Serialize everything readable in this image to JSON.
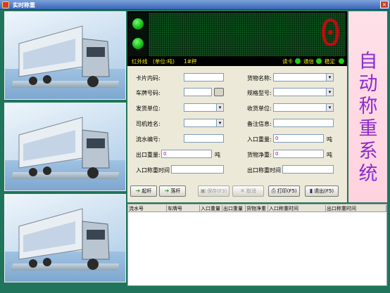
{
  "window": {
    "title": "实时称重"
  },
  "display": {
    "weight_value": "0",
    "infrared_label": "红外线",
    "unit_label": "(单位:吨)",
    "scale_label": "1#秤",
    "read_card_label": "读卡",
    "comm_label": "通信",
    "stable_label": "稳定"
  },
  "side_title": [
    "自",
    "动",
    "称",
    "重",
    "系",
    "统"
  ],
  "form": {
    "card_code_label": "卡片内码:",
    "plate_label": "车牌号码:",
    "shipper_label": "发货单位:",
    "driver_label": "司机姓名:",
    "serial_label": "流水编号:",
    "out_weight_label": "出口重量:",
    "in_time_label": "入口称重时间",
    "goods_name_label": "货物名称:",
    "spec_label": "规格型号:",
    "receiver_label": "收货单位:",
    "remark_label": "备注信息:",
    "in_weight_label": "入口重量:",
    "net_weight_label": "货物净重:",
    "out_time_label": "出口称重时间",
    "in_weight_value": "0",
    "out_weight_value": "0",
    "net_weight_value": "0",
    "unit_ton": "吨"
  },
  "buttons": {
    "raise": "起杆",
    "lower": "落杆",
    "save": "保存(F3)",
    "cancel": "取消",
    "print": "打印(F5)",
    "exit": "退出(F5)"
  },
  "table": {
    "columns": [
      "流水号",
      "车牌号",
      "入口重量",
      "出口重量",
      "货物净重",
      "入口称重时间",
      "出口称重时间"
    ]
  },
  "colors": {
    "accent": "#8a2bcf",
    "led_red": "#b50f0f",
    "indicator_green": "#18d018"
  }
}
